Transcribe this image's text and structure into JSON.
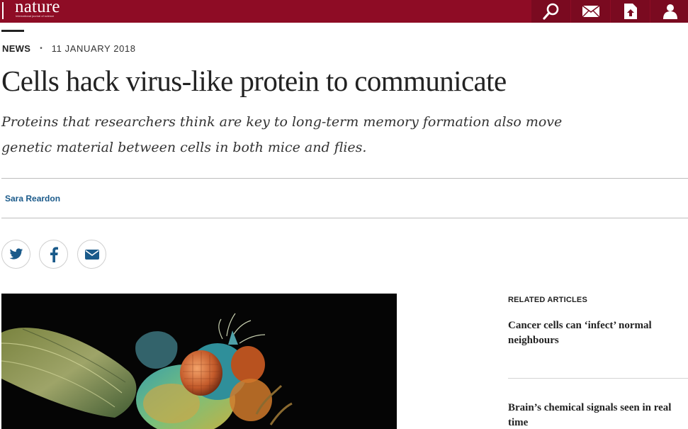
{
  "brand": {
    "name": "nature",
    "tagline": "International journal of science",
    "color": "#8e0c25"
  },
  "nav": {
    "icons": [
      "search-icon",
      "mail-icon",
      "upload-icon",
      "user-icon"
    ]
  },
  "article": {
    "kind": "NEWS",
    "date": "11 JANUARY 2018",
    "title": "Cells hack virus-like protein to communicate",
    "standfirst": "Proteins that researchers think are key to long-term memory formation also move genetic material between cells in both mice and flies.",
    "author": "Sara Reardon"
  },
  "share": {
    "icons": [
      "twitter-icon",
      "facebook-icon",
      "email-icon"
    ]
  },
  "related": {
    "heading": "RELATED ARTICLES",
    "items": [
      {
        "title": "Cancer cells can ‘infect’ normal neighbours"
      },
      {
        "title": "Brain’s chemical signals seen in real time"
      }
    ]
  }
}
